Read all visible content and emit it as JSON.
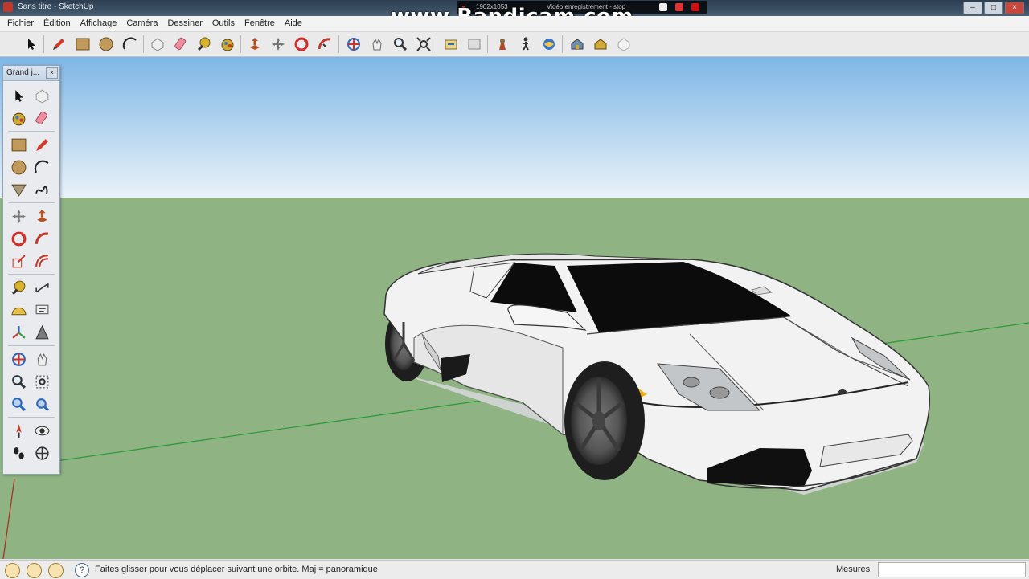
{
  "window": {
    "title": "Sans titre - SketchUp"
  },
  "overlay": {
    "watermark": "www.Bandicam.com",
    "recorder_resolution": "1902x1053",
    "recorder_mode": "Vidéo enregistrement - stop"
  },
  "menu": [
    "Fichier",
    "Édition",
    "Affichage",
    "Caméra",
    "Dessiner",
    "Outils",
    "Fenêtre",
    "Aide"
  ],
  "palette": {
    "title": "Grand j..."
  },
  "status": {
    "hint": "Faites glisser pour vous déplacer suivant une orbite.  Maj = panoramique",
    "measure_label": "Mesures",
    "measure_value": ""
  },
  "colors": {
    "sky_top": "#7fb6e6",
    "sky_bottom": "#e9f2f8",
    "ground": "#8fb382",
    "car_body": "#f2f2f2",
    "green_axis": "#2e9a3a",
    "red_axis": "#a8322b"
  },
  "toolbar_icons": [
    "select-icon",
    "pencil-icon",
    "rectangle-icon",
    "circle-icon",
    "arc-icon",
    "make-component-icon",
    "eraser-icon",
    "tape-measure-icon",
    "paint-bucket-icon",
    "push-pull-icon",
    "move-icon",
    "rotate-icon",
    "follow-me-icon",
    "orbit-icon",
    "pan-icon",
    "zoom-icon",
    "zoom-extents-icon",
    "previous-view-icon",
    "next-view-icon",
    "position-camera-icon",
    "walk-icon",
    "look-around-icon",
    "warehouse-icon",
    "share-model-icon",
    "components-icon"
  ],
  "palette_icons": [
    "select-icon",
    "make-component-icon",
    "paint-bucket-icon",
    "eraser-icon",
    "rectangle-icon",
    "pencil-icon",
    "circle-icon",
    "arc-icon",
    "polygon-icon",
    "freehand-icon",
    "move-icon",
    "push-pull-icon",
    "rotate-icon",
    "follow-me-icon",
    "scale-icon",
    "offset-icon",
    "tape-measure-icon",
    "dimension-icon",
    "protractor-icon",
    "text-icon",
    "axes-icon",
    "3d-text-icon",
    "orbit-icon",
    "pan-icon",
    "zoom-icon",
    "zoom-window-icon",
    "zoom-extents-icon",
    "previous-view-icon",
    "position-camera-icon",
    "look-around-icon",
    "walk-icon",
    "section-plane-icon"
  ]
}
